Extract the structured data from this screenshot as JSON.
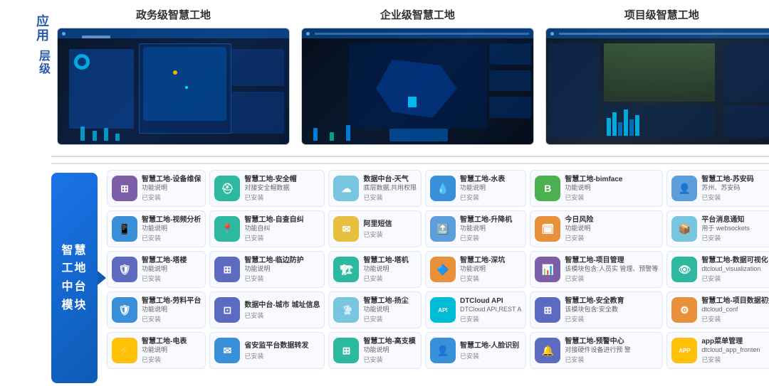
{
  "header": {
    "gov_title": "政务级智慧工地",
    "enterprise_title": "企业级智慧工地",
    "project_title": "项目级智慧工地"
  },
  "sidebar": {
    "app_label": "应用",
    "layer_label": "层级"
  },
  "modules_label": {
    "line1": "智慧",
    "line2": "工地",
    "line3": "中台",
    "line4": "模块"
  },
  "modules": [
    {
      "id": "m1",
      "icon_type": "icon-purple",
      "icon_symbol": "⊞",
      "name": "智慧工地-设备维保",
      "desc": "功能说明",
      "status": "已安装"
    },
    {
      "id": "m2",
      "icon_type": "icon-teal",
      "icon_symbol": "⛑",
      "name": "智慧工地-安全帽",
      "desc": "对接安全帽数据",
      "status": "已安装"
    },
    {
      "id": "m3",
      "icon_type": "icon-cyan",
      "icon_symbol": "☁",
      "name": "数据中台-天气",
      "desc": "底层数据,共用权限",
      "status": "已安装"
    },
    {
      "id": "m4",
      "icon_type": "icon-blue",
      "icon_symbol": "💧",
      "name": "智慧工地-水表",
      "desc": "功能说明",
      "status": "已安装"
    },
    {
      "id": "m5",
      "icon_type": "icon-bimgreen",
      "icon_symbol": "B",
      "name": "智慧工地-bimface",
      "desc": "功能说明",
      "status": "已安装"
    },
    {
      "id": "m6",
      "icon_type": "icon-person",
      "icon_symbol": "👤",
      "name": "智慧工地-苏安码",
      "desc": "苏州、苏安码",
      "status": "已安装"
    },
    {
      "id": "m7",
      "icon_type": "icon-blue",
      "icon_symbol": "📱",
      "name": "智慧工地-视频分析",
      "desc": "功能说明",
      "status": "已安装"
    },
    {
      "id": "m8",
      "icon_type": "icon-teal",
      "icon_symbol": "📍",
      "name": "智慧工地-自查自纠",
      "desc": "功能自纠",
      "status": "已安装"
    },
    {
      "id": "m9",
      "icon_type": "icon-blue",
      "icon_symbol": "✉",
      "name": "阿里短信",
      "desc": "",
      "status": "已安装"
    },
    {
      "id": "m10",
      "icon_type": "icon-cyan",
      "icon_symbol": "🔝",
      "name": "智慧工地-升降机",
      "desc": "功能说明",
      "status": "已安装"
    },
    {
      "id": "m11",
      "icon_type": "icon-orange",
      "icon_symbol": "🗓",
      "name": "今日风险",
      "desc": "功能说明",
      "status": "已安装"
    },
    {
      "id": "m12",
      "icon_type": "icon-cyan",
      "icon_symbol": "📦",
      "name": "平台消息通知",
      "desc": "用于 websockets",
      "status": "已安装"
    },
    {
      "id": "m13",
      "icon_type": "icon-indigo",
      "icon_symbol": "🛡",
      "name": "智慧工地-塔楼",
      "desc": "功能说明",
      "status": "已安装"
    },
    {
      "id": "m14",
      "icon_type": "icon-indigo",
      "icon_symbol": "⊞",
      "name": "智慧工地-临边防护",
      "desc": "功能说明",
      "status": "已安装"
    },
    {
      "id": "m15",
      "icon_type": "icon-teal",
      "icon_symbol": "🏗",
      "name": "智慧工地-塔机",
      "desc": "功能说明",
      "status": "已安装"
    },
    {
      "id": "m16",
      "icon_type": "icon-orange",
      "icon_symbol": "🔷",
      "name": "智慧工地-深坑",
      "desc": "功能说明",
      "status": "已安装"
    },
    {
      "id": "m17",
      "icon_type": "icon-purple",
      "icon_symbol": "📊",
      "name": "智慧工地-项目管理",
      "desc": "该模块包含:人员实\n管理、预警等",
      "status": "已安装"
    },
    {
      "id": "m18",
      "icon_type": "icon-teal",
      "icon_symbol": "💻",
      "name": "智慧工地-数据可视化",
      "desc": "dtcloud_visualization",
      "status": "已安装"
    },
    {
      "id": "m19",
      "icon_type": "icon-blue",
      "icon_symbol": "🛡",
      "name": "智慧工地-劳料平台",
      "desc": "功能说明",
      "status": "已安装"
    },
    {
      "id": "m20",
      "icon_type": "icon-indigo",
      "icon_symbol": "⊡",
      "name": "数据中台-城市\n城址信息",
      "desc": "",
      "status": "已安装"
    },
    {
      "id": "m21",
      "icon_type": "icon-cyan",
      "icon_symbol": "💨",
      "name": "智慧工地-扬尘",
      "desc": "功能说明",
      "status": "已安装"
    },
    {
      "id": "m22",
      "icon_type": "icon-api",
      "icon_symbol": "API",
      "name": "DTCloud API",
      "desc": "DTCloud API,REST A",
      "status": "已安装"
    },
    {
      "id": "m23",
      "icon_type": "icon-purple",
      "icon_symbol": "⊞",
      "name": "智慧工地-安全教育",
      "desc": "该模块包含:安全教",
      "status": "已安装"
    },
    {
      "id": "m24",
      "icon_type": "icon-orange",
      "icon_symbol": "⚙",
      "name": "智慧工地-项目数据初始化",
      "desc": "dtcloud_conf",
      "status": "已安装"
    },
    {
      "id": "m25",
      "icon_type": "icon-amber",
      "icon_symbol": "⚡",
      "name": "智慧工地-电表",
      "desc": "功能说明",
      "status": "已安装"
    },
    {
      "id": "m26",
      "icon_type": "icon-blue",
      "icon_symbol": "✉",
      "name": "省安监平台数据转发",
      "desc": "",
      "status": "已安装"
    },
    {
      "id": "m27",
      "icon_type": "icon-teal",
      "icon_symbol": "⊞",
      "name": "智慧工地-高支模",
      "desc": "功能说明",
      "status": "已安装"
    },
    {
      "id": "m28",
      "icon_type": "icon-blue",
      "icon_symbol": "👤",
      "name": "智慧工地-人脸识别",
      "desc": "",
      "status": "已安装"
    },
    {
      "id": "m29",
      "icon_type": "icon-indigo",
      "icon_symbol": "🔔",
      "name": "智慧工地-预警中心",
      "desc": "对接硬件设备进行预\n警",
      "status": "已安装"
    },
    {
      "id": "m30",
      "icon_type": "icon-amber",
      "icon_symbol": "APP",
      "name": "app菜单管理",
      "desc": "dtcloud_app_fronten",
      "status": "已安装"
    }
  ]
}
